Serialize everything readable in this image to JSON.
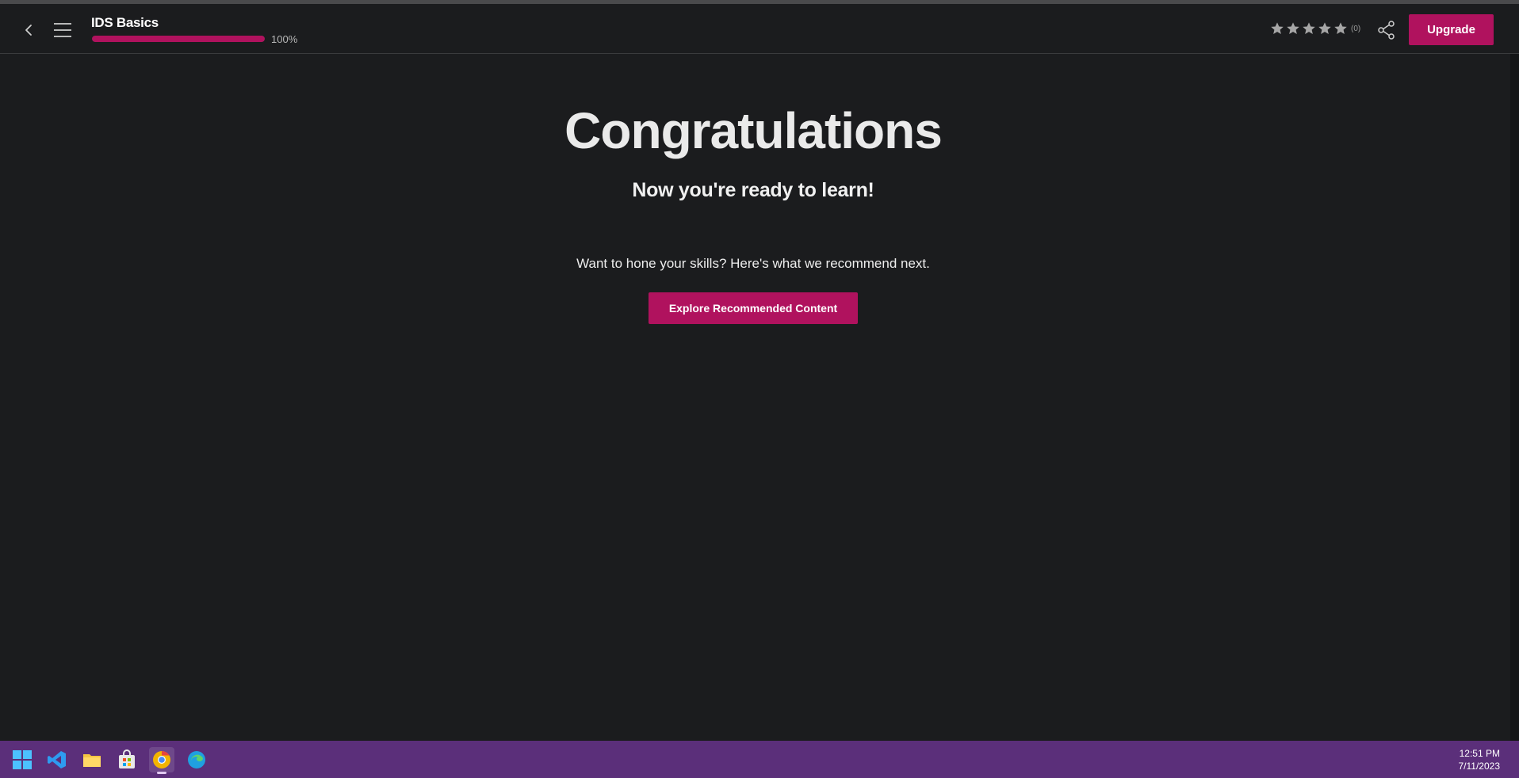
{
  "header": {
    "course_title": "IDS Basics",
    "progress_percent": 100,
    "progress_label": "100%",
    "rating_count": "(0)",
    "upgrade_label": "Upgrade"
  },
  "main": {
    "headline": "Congratulations",
    "subheadline": "Now you're ready to learn!",
    "recommend_text": "Want to hone your skills? Here's what we recommend next.",
    "explore_label": "Explore Recommended Content"
  },
  "taskbar": {
    "time": "12:51 PM",
    "date": "7/11/2023"
  },
  "colors": {
    "accent": "#b0125e",
    "background": "#1b1c1e",
    "taskbar": "#5b2f7a"
  }
}
